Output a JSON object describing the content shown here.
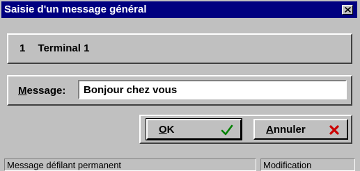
{
  "window": {
    "title": "Saisie d'un message général",
    "close_label": "×"
  },
  "terminal": {
    "number": "1",
    "name": "Terminal 1"
  },
  "message": {
    "label_first": "M",
    "label_rest": "essage:",
    "value": "Bonjour chez vous"
  },
  "buttons": {
    "ok_u": "O",
    "ok_rest": "K",
    "cancel_u": "A",
    "cancel_rest": "nnuler"
  },
  "status": {
    "left": "Message défilant permanent",
    "right": "Modification"
  },
  "colors": {
    "titlebar": "#000080",
    "ok_check": "#008000",
    "cancel_x": "#cc0000"
  },
  "icons": {
    "ok": "checkmark-icon",
    "cancel": "red-x-icon",
    "close": "close-icon"
  }
}
